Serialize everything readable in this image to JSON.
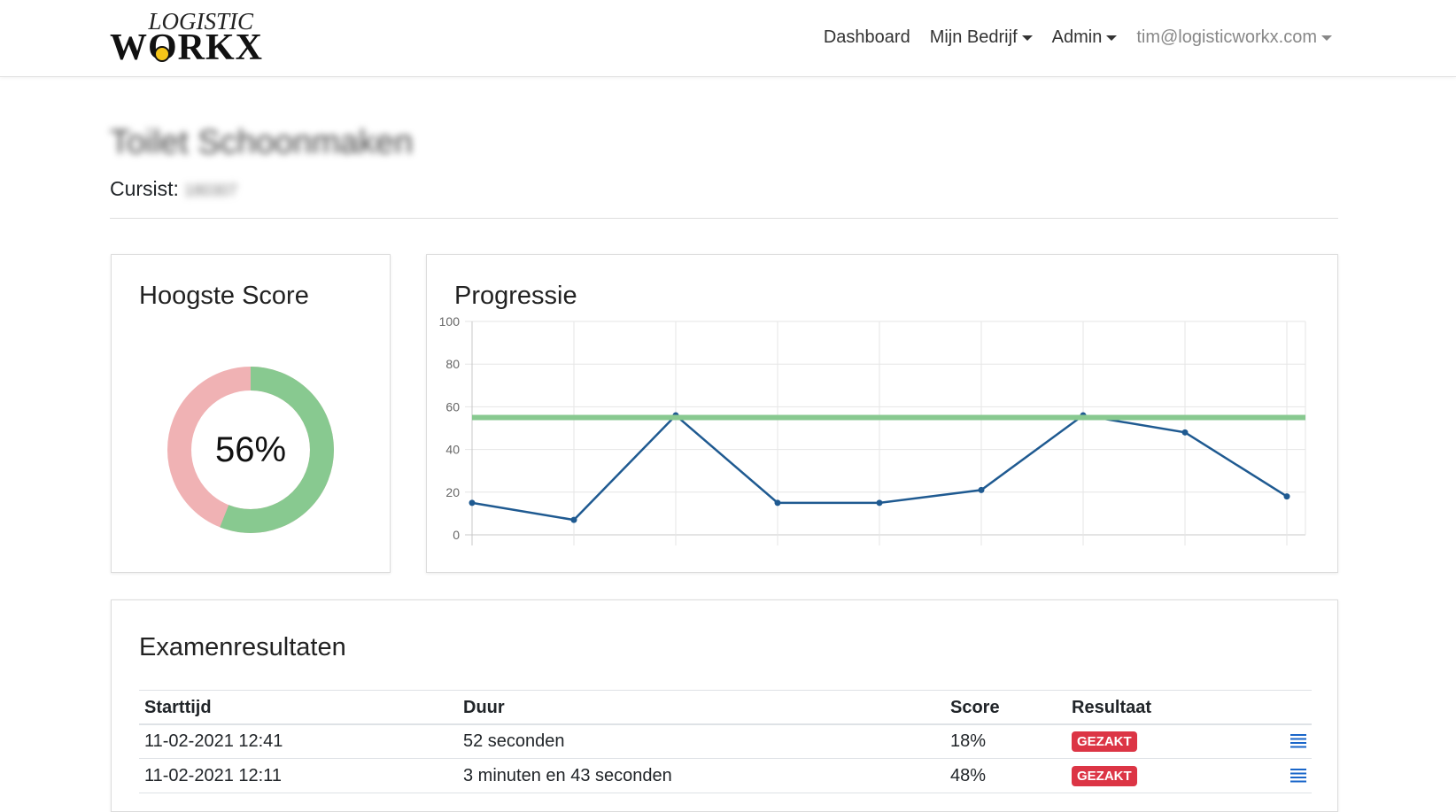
{
  "brand": {
    "top": "LOGISTIC",
    "main": "WORKX"
  },
  "nav": {
    "dashboard": "Dashboard",
    "company": "Mijn Bedrijf",
    "admin": "Admin",
    "user": "tim@logisticworkx.com"
  },
  "page": {
    "title": "Toilet Schoonmaken",
    "cursist_label": "Cursist:",
    "cursist_value": "180307"
  },
  "score_card": {
    "title": "Hoogste Score",
    "value": "56%",
    "percent": 56,
    "pass_color": "#88c990",
    "fail_color": "#f0b2b4"
  },
  "progress_card": {
    "title": "Progressie"
  },
  "chart_data": {
    "type": "line",
    "x": [
      1,
      2,
      3,
      4,
      5,
      6,
      7,
      8,
      9
    ],
    "series": [
      {
        "values": [
          15,
          7,
          56,
          15,
          15,
          21,
          56,
          48,
          18
        ],
        "color": "#1f5a91"
      },
      {
        "values": [
          55,
          55,
          55,
          55,
          55,
          55,
          55,
          55,
          55
        ],
        "color": "#88c990"
      }
    ],
    "yticks": [
      "0",
      "20",
      "40",
      "60",
      "80",
      "100"
    ],
    "ylim": [
      0,
      100
    ],
    "grid": true
  },
  "results": {
    "title": "Examenresultaten",
    "headers": [
      "Starttijd",
      "Duur",
      "Score",
      "Resultaat"
    ],
    "rows": [
      {
        "start": "11-02-2021 12:41",
        "duration": "52 seconden",
        "score": "18%",
        "result": "GEZAKT"
      },
      {
        "start": "11-02-2021 12:11",
        "duration": "3 minuten en 43 seconden",
        "score": "48%",
        "result": "GEZAKT"
      }
    ]
  }
}
